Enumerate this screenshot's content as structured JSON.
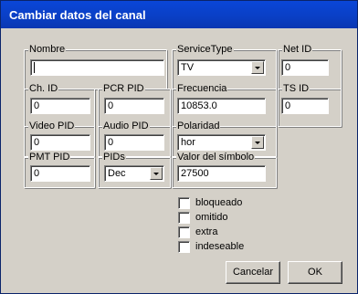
{
  "window": {
    "title": "Cambiar datos del canal"
  },
  "fields": {
    "nombre": {
      "label": "Nombre",
      "value": ""
    },
    "service_type": {
      "label": "ServiceType",
      "value": "TV"
    },
    "net_id": {
      "label": "Net ID",
      "value": "0"
    },
    "ch_id": {
      "label": "Ch. ID",
      "value": "0"
    },
    "pcr_pid": {
      "label": "PCR PID",
      "value": "0"
    },
    "frecuencia": {
      "label": "Frecuencia",
      "value": "10853.0"
    },
    "ts_id": {
      "label": "TS ID",
      "value": "0"
    },
    "video_pid": {
      "label": "Video PID",
      "value": "0"
    },
    "audio_pid": {
      "label": "Audio PID",
      "value": "0"
    },
    "polaridad": {
      "label": "Polaridad",
      "value": "hor"
    },
    "pmt_pid": {
      "label": "PMT PID",
      "value": "0"
    },
    "pids": {
      "label": "PIDs",
      "value": "Dec"
    },
    "valor_simbolo": {
      "label": "Valor del símbolo",
      "value": "27500"
    }
  },
  "checkboxes": [
    {
      "label": "bloqueado",
      "checked": false
    },
    {
      "label": "omitido",
      "checked": false
    },
    {
      "label": "extra",
      "checked": false
    },
    {
      "label": "indeseable",
      "checked": false
    }
  ],
  "buttons": {
    "cancel": "Cancelar",
    "ok": "OK"
  }
}
